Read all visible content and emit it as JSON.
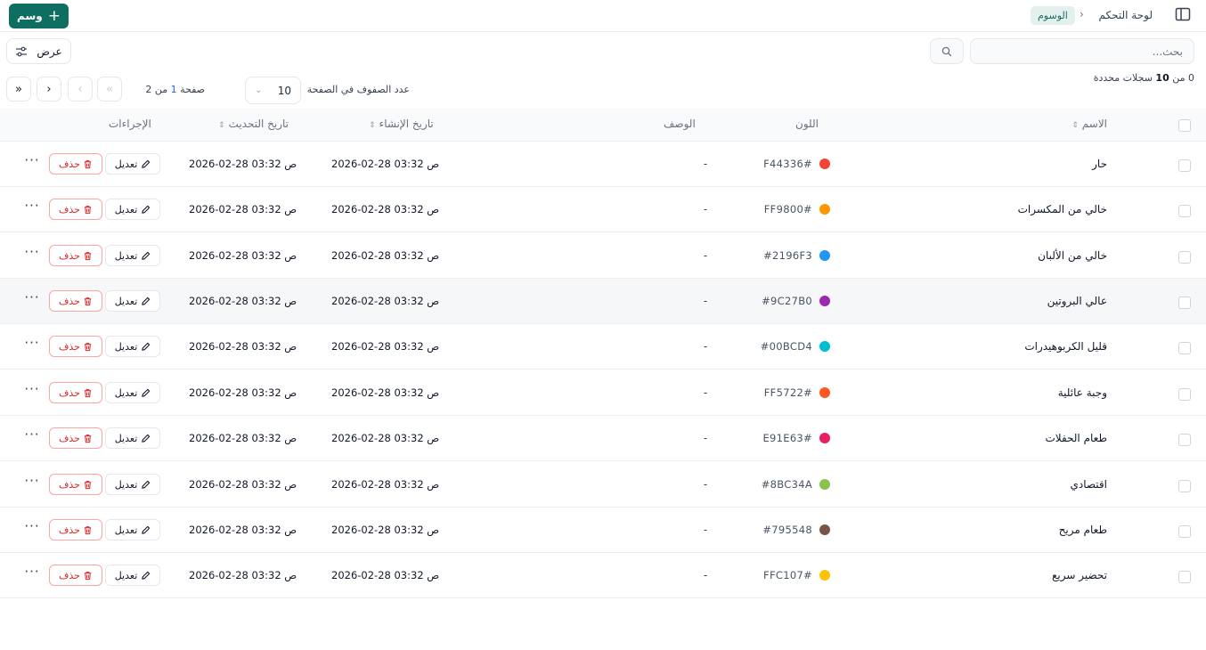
{
  "header": {
    "breadcrumb_home": "لوحة التحكم",
    "breadcrumb_current": "الوسوم",
    "new_button_label": "وسم"
  },
  "toolbar": {
    "search_placeholder": "بحث...",
    "view_button_label": "عرض"
  },
  "pagination": {
    "selected_count_prefix": "0 من",
    "total_count": "10",
    "selected_count_suffix": "سجلات محددة",
    "rows_per_page_label": "عدد الصفوف في الصفحة",
    "rows_per_page_value": "10",
    "page_label": "صفحة",
    "current_page": "1",
    "of_label": "من",
    "total_pages": "2"
  },
  "table": {
    "columns": {
      "name": "الاسم",
      "color": "اللون",
      "description": "الوصف",
      "created": "تاريخ الإنشاء",
      "updated": "تاريخ التحديث",
      "actions": "الإجراءات"
    },
    "edit_label": "تعديل",
    "delete_label": "حذف",
    "more_label": "···",
    "rows": [
      {
        "name": "حار",
        "color_label": "F44336#",
        "color": "#F44336",
        "description": "-",
        "created": "2026-02-28 03:32 ص",
        "updated": "2026-02-28 03:32 ص"
      },
      {
        "name": "خالي من المكسرات",
        "color_label": "FF9800#",
        "color": "#FF9800",
        "description": "-",
        "created": "2026-02-28 03:32 ص",
        "updated": "2026-02-28 03:32 ص"
      },
      {
        "name": "خالي من الألبان",
        "color_label": "#2196F3",
        "color": "#2196F3",
        "description": "-",
        "created": "2026-02-28 03:32 ص",
        "updated": "2026-02-28 03:32 ص"
      },
      {
        "name": "عالي البروتين",
        "color_label": "#9C27B0",
        "color": "#9C27B0",
        "description": "-",
        "created": "2026-02-28 03:32 ص",
        "updated": "2026-02-28 03:32 ص"
      },
      {
        "name": "قليل الكربوهيدرات",
        "color_label": "#00BCD4",
        "color": "#00BCD4",
        "description": "-",
        "created": "2026-02-28 03:32 ص",
        "updated": "2026-02-28 03:32 ص"
      },
      {
        "name": "وجبة عائلية",
        "color_label": "FF5722#",
        "color": "#FF5722",
        "description": "-",
        "created": "2026-02-28 03:32 ص",
        "updated": "2026-02-28 03:32 ص"
      },
      {
        "name": "طعام الحفلات",
        "color_label": "E91E63#",
        "color": "#E91E63",
        "description": "-",
        "created": "2026-02-28 03:32 ص",
        "updated": "2026-02-28 03:32 ص"
      },
      {
        "name": "اقتصادي",
        "color_label": "#8BC34A",
        "color": "#8BC34A",
        "description": "-",
        "created": "2026-02-28 03:32 ص",
        "updated": "2026-02-28 03:32 ص"
      },
      {
        "name": "طعام مريح",
        "color_label": "#795548",
        "color": "#795548",
        "description": "-",
        "created": "2026-02-28 03:32 ص",
        "updated": "2026-02-28 03:32 ص"
      },
      {
        "name": "تحضير سريع",
        "color_label": "FFC107#",
        "color": "#FFC107",
        "description": "-",
        "created": "2026-02-28 03:32 ص",
        "updated": "2026-02-28 03:32 ص"
      }
    ]
  },
  "colors": {
    "accent": "#0F6E62",
    "breadcrumb_badge_bg": "#E3F0EE",
    "delete": "#DC2626",
    "page_number": "#2563EB"
  }
}
